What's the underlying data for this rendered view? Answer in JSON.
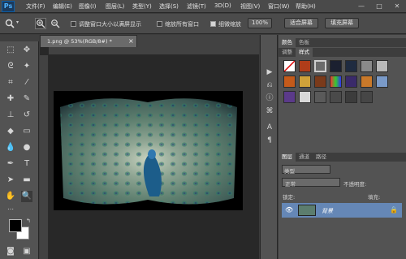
{
  "app": {
    "logo": "Ps"
  },
  "menu": {
    "items": [
      "文件(F)",
      "编辑(E)",
      "图像(I)",
      "图层(L)",
      "类型(Y)",
      "选择(S)",
      "滤镜(T)",
      "3D(D)",
      "视图(V)",
      "窗口(W)",
      "帮助(H)"
    ]
  },
  "window_controls": {
    "minimize": "—",
    "restore": "□",
    "close": "✕"
  },
  "options": {
    "zoom_resize_label": "调整窗口大小以满屏显示",
    "zoom_all_label": "缩放所有窗口",
    "scrubby_label": "细微缩放",
    "zoom_resize_checked": false,
    "zoom_all_checked": false,
    "scrubby_checked": true,
    "percent_btn": "100%",
    "fit_screen_btn": "适合屏幕",
    "fill_screen_btn": "填充屏幕"
  },
  "document": {
    "tab_title": "1.png @ 53%(RGB/8#) *",
    "tab_close": "×"
  },
  "panels": {
    "color_tabs": [
      "颜色",
      "色板"
    ],
    "adjust_tabs": [
      "调整",
      "样式"
    ],
    "layer_tabs": [
      "图层",
      "通道",
      "路径"
    ],
    "layer_kind": "类型",
    "blend_mode": "正常",
    "opacity_label": "不透明度:",
    "lock_label": "锁定:",
    "fill_label": "填充:",
    "layer_name": "背景"
  },
  "colors": {
    "accent": "#6587b6",
    "foreground": "#000000",
    "background": "#ffffff"
  }
}
